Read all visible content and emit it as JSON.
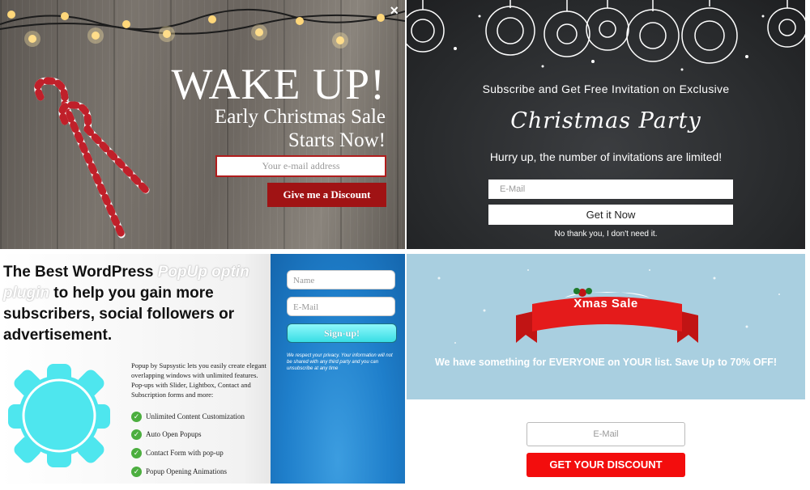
{
  "panel_wake_up": {
    "title": "WAKE UP!",
    "subtitle": "Early Christmas Sale Starts Now!",
    "email_placeholder": "Your e-mail address",
    "button_label": "Give me a Discount",
    "close_label": "×",
    "accent_color": "#a01314"
  },
  "panel_christmas_party": {
    "line1": "Subscribe and Get Free Invitation on Exclusive",
    "headline": "Christmas Party",
    "line2": "Hurry up, the number of invitations are limited!",
    "email_placeholder": "E-Mail",
    "button_label": "Get it Now",
    "decline_label": "No thank you, I don't need it."
  },
  "panel_supsystic": {
    "heading_pre": "The Best WordPress ",
    "heading_highlight": "PopUp optin plugin",
    "heading_post": " to help you gain more subscribers, social followers or advertisement.",
    "description": "Popup by Supsystic lets you easily create elegant overlapping windows with unlimited features. Pop-ups with Slider, Lightbox, Contact and Subscription forms and more:",
    "features": [
      "Unlimited Content Customization",
      "Auto Open Popups",
      "Contact Form with pop-up",
      "Popup Opening Animations"
    ],
    "name_placeholder": "Name",
    "email_placeholder": "E-Mail",
    "button_label": "Sign-up!",
    "privacy_text": "We respect your privacy. Your information will not be shared with any third party and you can unsubscribe at any time",
    "gear_color": "#4ee6ee"
  },
  "panel_xmas_sale": {
    "ribbon_label": "Xmas Sale",
    "message": "We have something for EVERYONE on YOUR list. Save Up to 70% OFF!",
    "email_placeholder": "E-Mail",
    "button_label": "GET YOUR DISCOUNT",
    "accent_color": "#f30d0d"
  }
}
